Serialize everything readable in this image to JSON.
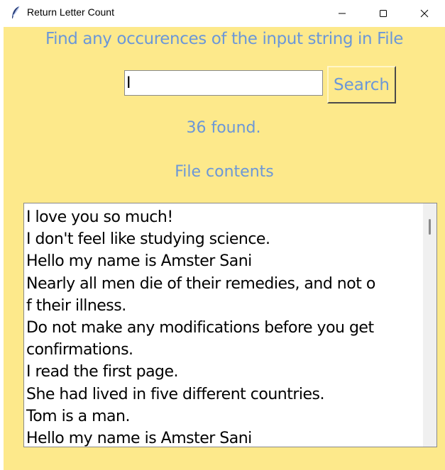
{
  "window": {
    "title": "Return Letter Count",
    "app_icon": "feather-icon",
    "controls": {
      "minimize": "minimize-icon",
      "maximize": "maximize-icon",
      "close": "close-icon"
    }
  },
  "colors": {
    "background": "#fde98b",
    "label_text": "#6b97d8",
    "field_bg": "#ffffff"
  },
  "header": {
    "label": "Find any occurences of the input string in File"
  },
  "search": {
    "value": "I",
    "button_label": "Search"
  },
  "result": {
    "found_text": "36 found."
  },
  "file": {
    "label": "File contents",
    "lines": [
      "I love you so much!",
      "I don't feel like studying science.",
      "Hello my name is Amster Sani",
      "Nearly all men die of their remedies, and not o",
      "f their illness.",
      "Do not make any modifications before you get",
      "confirmations.",
      "I read the first page.",
      "She had lived in five different countries.",
      "Tom is a man.",
      "Hello my name is Amster Sani"
    ]
  }
}
